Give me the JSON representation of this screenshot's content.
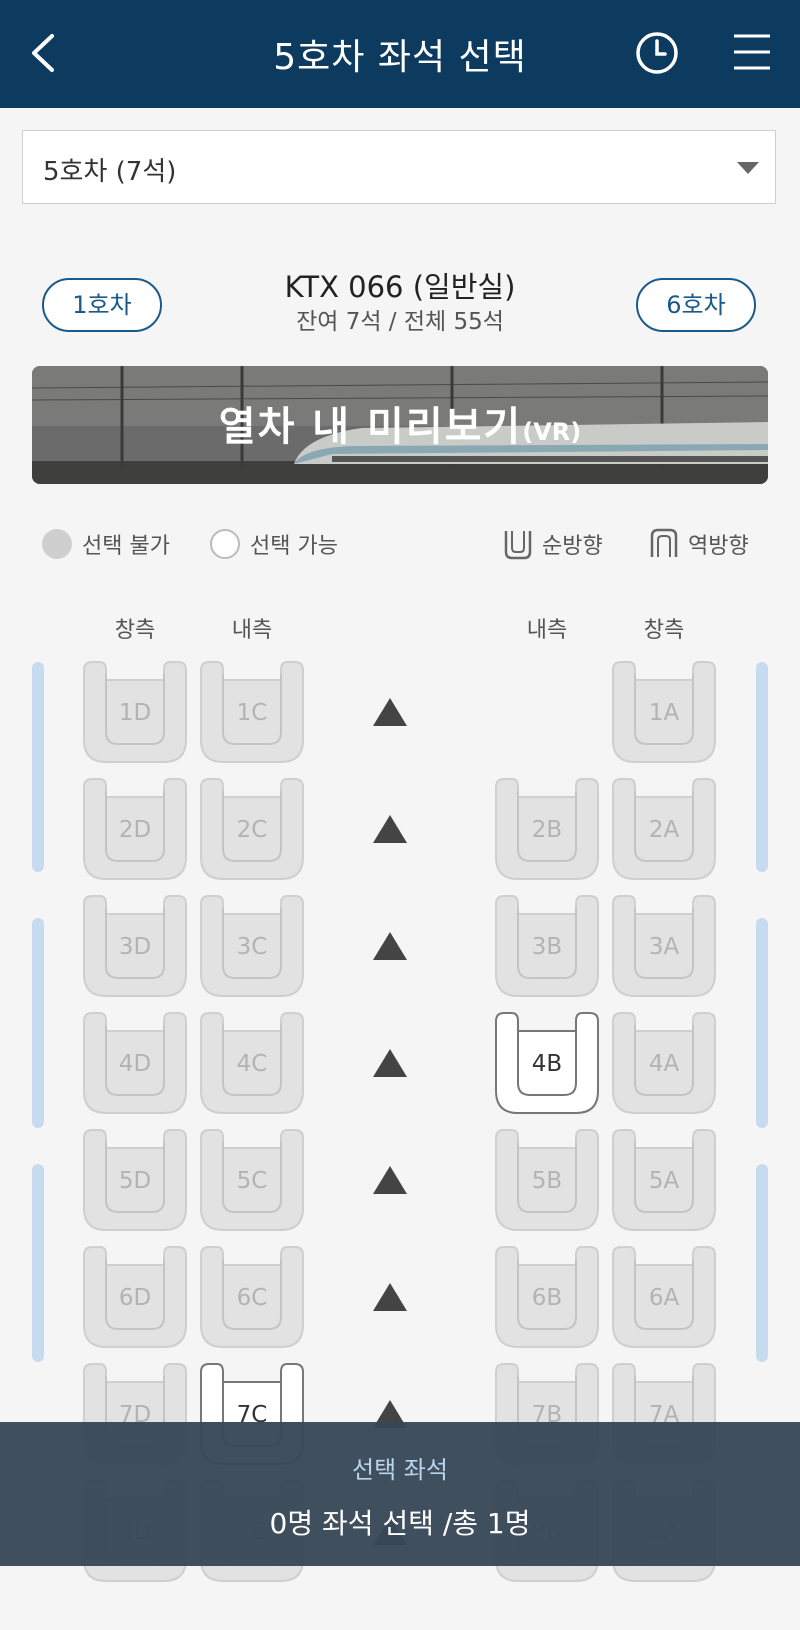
{
  "header": {
    "title": "5호차 좌석 선택",
    "back_icon": "chevron-left-icon",
    "history_icon": "clock-icon",
    "menu_icon": "hamburger-menu-icon",
    "bg_color": "#0d3a5f"
  },
  "car_select": {
    "value": "5호차 (7석)"
  },
  "train": {
    "name": "KTX 066 (일반실)",
    "remaining": "잔여 7석 / 전체 55석",
    "prev_car_label": "1호차",
    "next_car_label": "6호차"
  },
  "vr_banner": {
    "label": "열차 내 미리보기",
    "suffix": "(VR)"
  },
  "legend": {
    "unavailable": "선택 불가",
    "available": "선택 가능",
    "forward": "순방향",
    "reverse": "역방향"
  },
  "columns": {
    "left_window": "창측",
    "left_aisle": "내측",
    "right_aisle": "내측",
    "right_window": "창측"
  },
  "seat_rows": [
    {
      "row": 1,
      "D": {
        "code": "1D",
        "available": false
      },
      "C": {
        "code": "1C",
        "available": false
      },
      "B": null,
      "A": {
        "code": "1A",
        "available": false
      }
    },
    {
      "row": 2,
      "D": {
        "code": "2D",
        "available": false
      },
      "C": {
        "code": "2C",
        "available": false
      },
      "B": {
        "code": "2B",
        "available": false
      },
      "A": {
        "code": "2A",
        "available": false
      }
    },
    {
      "row": 3,
      "D": {
        "code": "3D",
        "available": false
      },
      "C": {
        "code": "3C",
        "available": false
      },
      "B": {
        "code": "3B",
        "available": false
      },
      "A": {
        "code": "3A",
        "available": false
      }
    },
    {
      "row": 4,
      "D": {
        "code": "4D",
        "available": false
      },
      "C": {
        "code": "4C",
        "available": false
      },
      "B": {
        "code": "4B",
        "available": true
      },
      "A": {
        "code": "4A",
        "available": false
      }
    },
    {
      "row": 5,
      "D": {
        "code": "5D",
        "available": false
      },
      "C": {
        "code": "5C",
        "available": false
      },
      "B": {
        "code": "5B",
        "available": false
      },
      "A": {
        "code": "5A",
        "available": false
      }
    },
    {
      "row": 6,
      "D": {
        "code": "6D",
        "available": false
      },
      "C": {
        "code": "6C",
        "available": false
      },
      "B": {
        "code": "6B",
        "available": false
      },
      "A": {
        "code": "6A",
        "available": false
      }
    },
    {
      "row": 7,
      "D": {
        "code": "7D",
        "available": false
      },
      "C": {
        "code": "7C",
        "available": true
      },
      "B": {
        "code": "7B",
        "available": false
      },
      "A": {
        "code": "7A",
        "available": false
      }
    },
    {
      "row": 8,
      "D": {
        "code": "8D",
        "available": false
      },
      "C": {
        "code": "8C",
        "available": false
      },
      "B": {
        "code": "8B",
        "available": false
      },
      "A": {
        "code": "8A",
        "available": false
      }
    }
  ],
  "direction_icon": "triangle-up-icon",
  "bottom": {
    "label": "선택 좌석",
    "count": "0명 좌석 선택 /총 1명"
  },
  "colors": {
    "accent": "#1a5a8a",
    "seat_unavailable_fill": "#e2e2e2",
    "seat_available_fill": "#ffffff",
    "window_bar": "#c7dbef",
    "bottom_bar": "#384856"
  }
}
